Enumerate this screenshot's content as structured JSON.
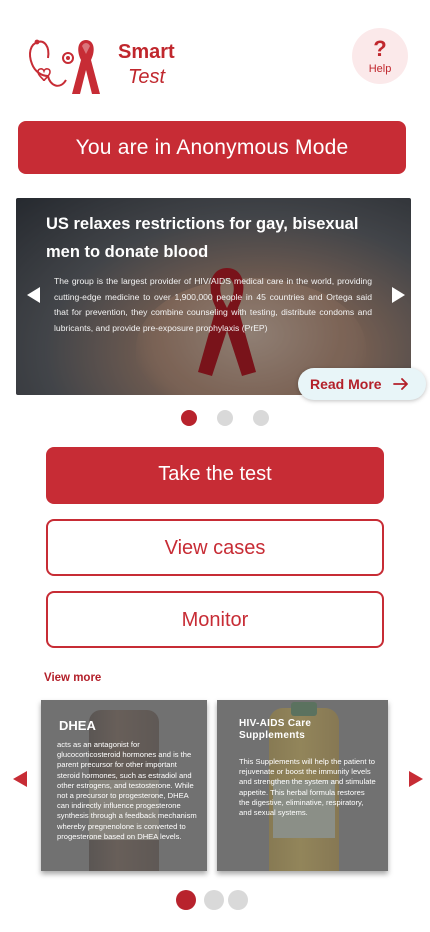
{
  "header": {
    "brand_title": "Smart",
    "brand_subtitle": "Test",
    "help_icon": "?",
    "help_label": "Help"
  },
  "banner": {
    "text": "You are in Anonymous Mode"
  },
  "news": {
    "title": "US relaxes restrictions for gay, bisexual men to donate blood",
    "body": "The group is the largest provider of HIV/AIDS medical care in the world, providing cutting-edge medicine to over 1,900,000 people in 45 countries and Ortega said that for prevention, they combine counseling with testing, distribute condoms and lubricants, and provide pre-exposure prophylaxis (PrEP)",
    "read_more": "Read More",
    "active_slide": 1,
    "slide_count": 3
  },
  "actions": {
    "take_test": "Take the test",
    "view_cases": "View cases",
    "monitor": "Monitor"
  },
  "products": {
    "view_more": "View more",
    "items": [
      {
        "title": "DHEA",
        "description": "acts as an antagonist for glucocorticosteroid hormones and is the parent precursor for other important steroid hormones, such as estradiol and other estrogens, and testosterone. While not a precursor to progesterone, DHEA can indirectly influence progesterone synthesis through a feedback mechanism whereby pregnenolone is converted to progesterone based on DHEA levels."
      },
      {
        "title": "HIV-AIDS Care Supplements",
        "description": "This Supplements will help the patient to rejuvenate or boost the immunity levels and strengthen the system and stimulate appetite. This herbal formula restores the digestive, eliminative, respiratory, and sexual systems."
      }
    ],
    "active_page": 1,
    "page_count": 3
  },
  "colors": {
    "brand_red": "#c72c35",
    "help_bg": "#fbe9ea",
    "read_more_bg": "#e8f5f8",
    "inactive_dot": "#d9d9d9"
  },
  "icons": {
    "logo": "stethoscope-ribbon-logo",
    "help": "question-mark-icon",
    "carousel_prev": "triangle-left-icon",
    "carousel_next": "triangle-right-icon",
    "read_more": "arrow-right-icon"
  }
}
